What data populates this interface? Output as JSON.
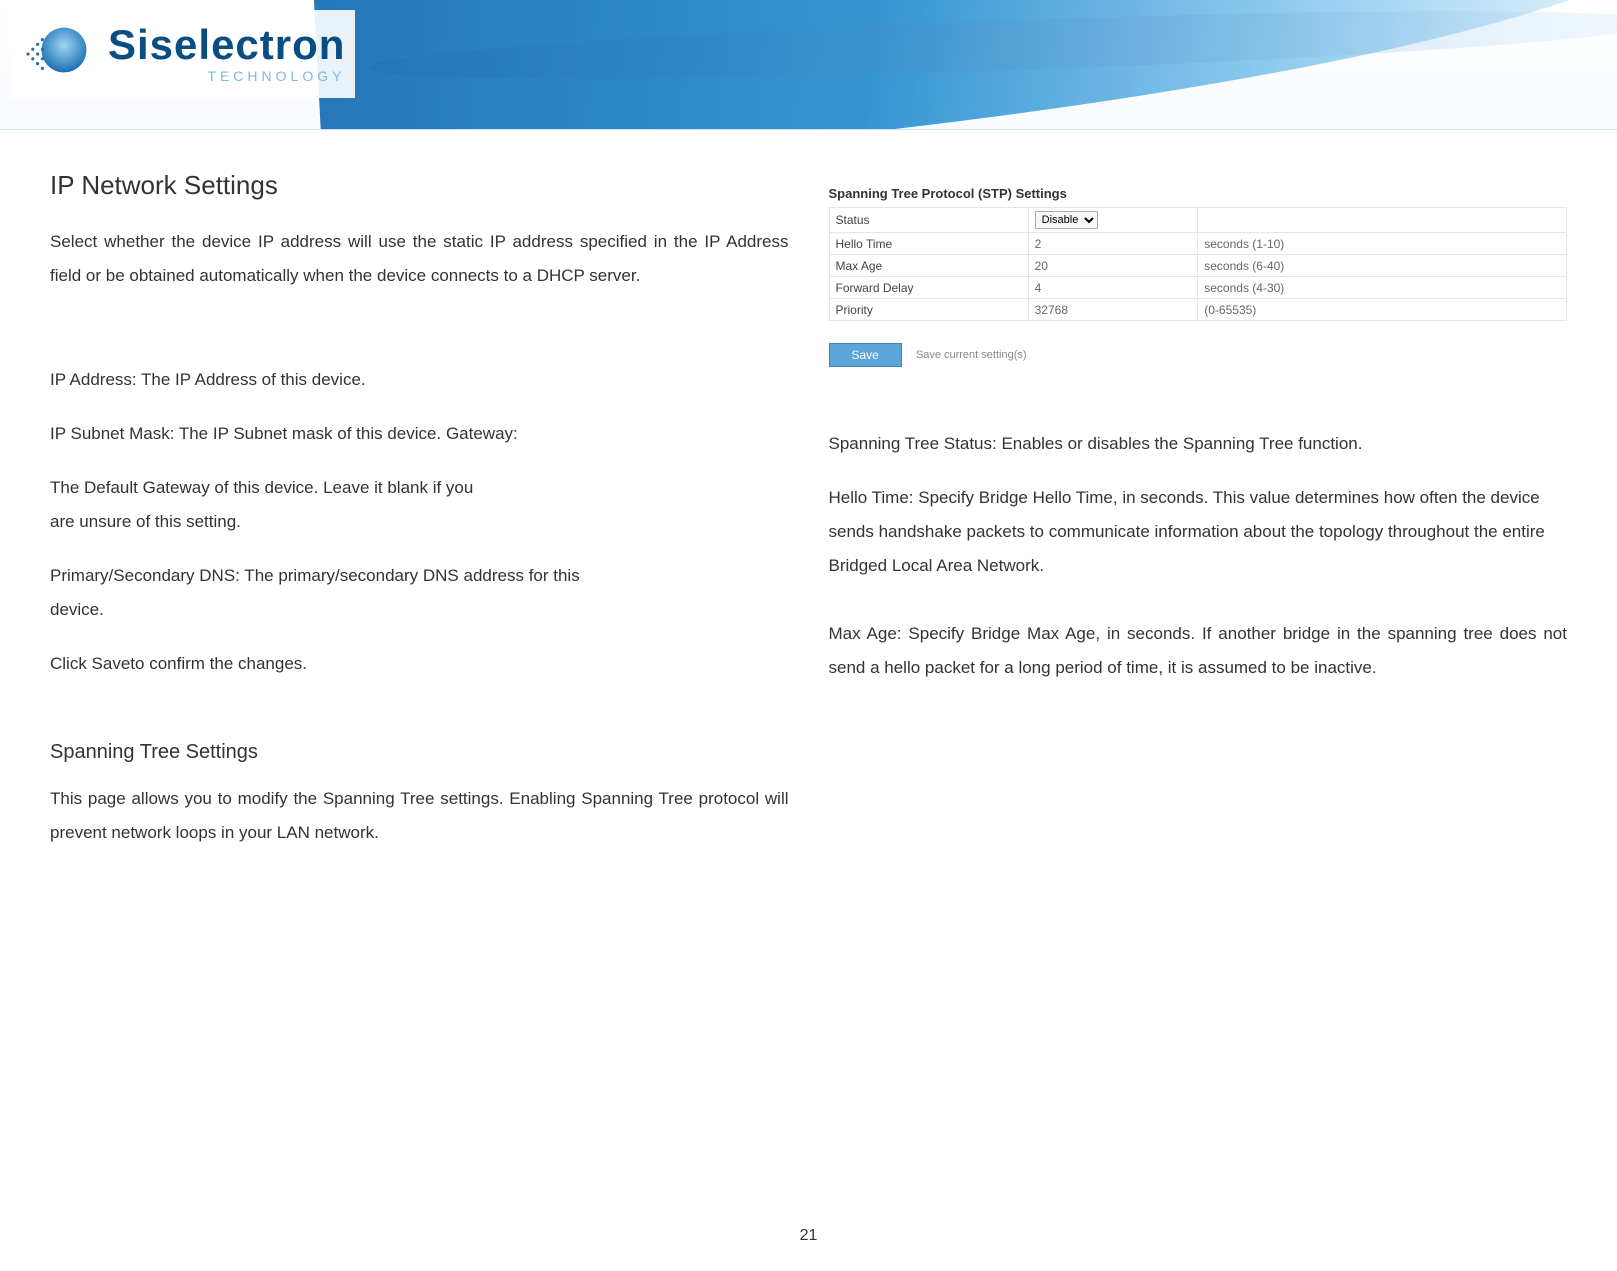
{
  "brand": {
    "name": "Siselectron",
    "sub": "TECHNOLOGY"
  },
  "left": {
    "h_ip": "IP Network Settings",
    "ip_intro": "Select whether the device IP address will use the static IP address specified in the IP Address field or be obtained automatically when the device connects to a DHCP server.",
    "ip_addr": "IP Address: The IP Address of this device.",
    "ip_mask": "IP Subnet Mask: The IP Subnet mask of this device. Gateway:",
    "gateway": "The Default Gateway of this device. Leave it blank if you are unsure of this setting.",
    "dns": "Primary/Secondary DNS: The primary/secondary DNS address for this device.",
    "save": "Click Saveto confirm the changes.",
    "h_stp": "Spanning Tree Settings",
    "stp_intro": "This page allows you to modify the Spanning Tree settings. Enabling Spanning Tree protocol will prevent network loops in your LAN network."
  },
  "stp_panel": {
    "title": "Spanning Tree Protocol (STP) Settings",
    "rows": {
      "status_label": "Status",
      "status_value": "Disable",
      "hello_label": "Hello Time",
      "hello_value": "2",
      "hello_hint": "seconds (1-10)",
      "maxage_label": "Max Age",
      "maxage_value": "20",
      "maxage_hint": "seconds (6-40)",
      "fwd_label": "Forward Delay",
      "fwd_value": "4",
      "fwd_hint": "seconds (4-30)",
      "prio_label": "Priority",
      "prio_value": "32768",
      "prio_hint": "(0-65535)"
    },
    "save_btn": "Save",
    "save_hint": "Save current setting(s)"
  },
  "right": {
    "stp_status": "Spanning Tree Status: Enables or disables the Spanning Tree function.",
    "hello": "Hello Time: Specify Bridge Hello Time, in seconds. This value determines how often the device sends handshake packets to communicate information about the topology throughout the entire Bridged Local Area Network.",
    "maxage": "Max Age: Specify Bridge Max Age, in seconds. If another bridge in the spanning tree does not send a hello packet for a long period of time, it is assumed to be inactive."
  },
  "page": "21"
}
